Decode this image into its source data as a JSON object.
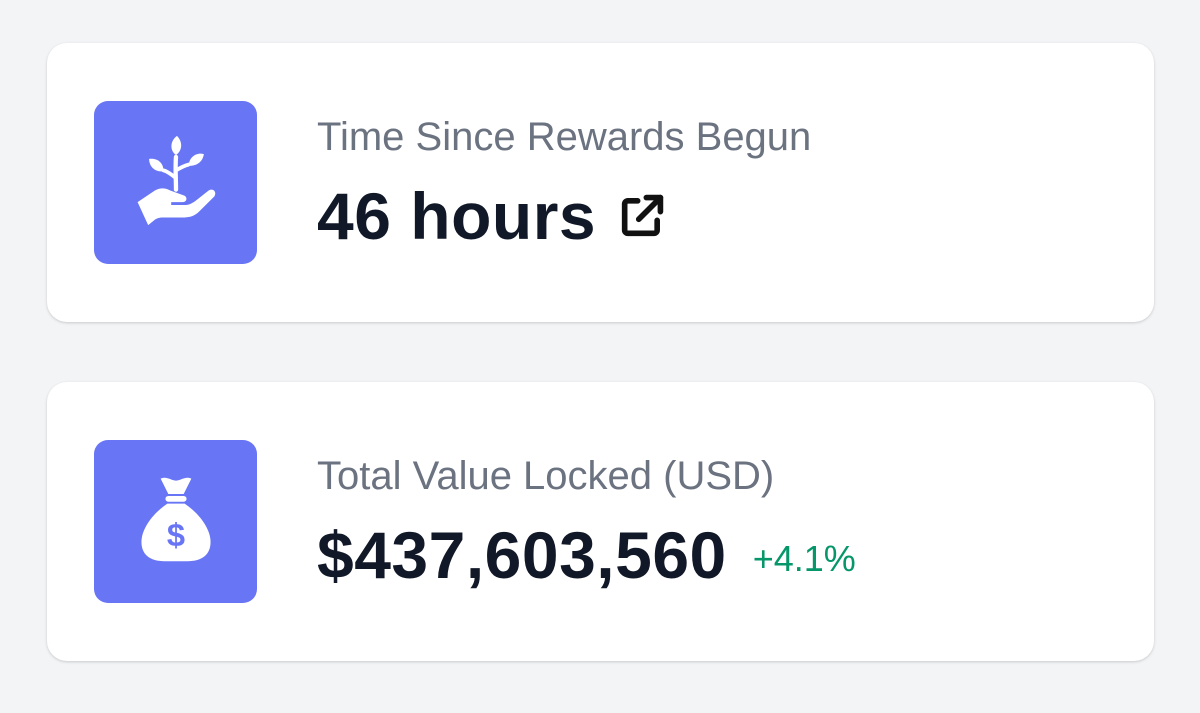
{
  "theme": {
    "icon_tile_color": "#6875f5",
    "positive_change_color": "#059669"
  },
  "stats": [
    {
      "icon": "plant-in-hand-icon",
      "label": "Time Since Rewards Begun",
      "value": "46 hours",
      "action_icon": "external-link-icon"
    },
    {
      "icon": "money-bag-icon",
      "label": "Total Value Locked (USD)",
      "value": "$437,603,560",
      "change": "+4.1%"
    }
  ]
}
